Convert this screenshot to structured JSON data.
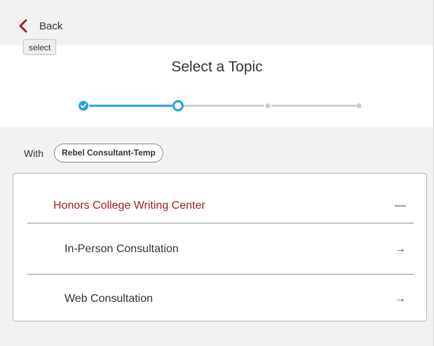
{
  "nav": {
    "back_label": "Back",
    "tooltip": "select"
  },
  "header": {
    "title": "Select a Topic"
  },
  "stepper": {
    "steps": 4,
    "current": 2,
    "accent": "#1fa3e0",
    "inactive": "#cccccc"
  },
  "with": {
    "label": "With",
    "consultant": "Rebel Consultant-Temp"
  },
  "topics": {
    "group_label": "Honors College Writing Center",
    "collapse_icon": "minus-icon",
    "items": [
      {
        "label": "In-Person Consultation",
        "icon": "arrow-right-icon"
      },
      {
        "label": "Web Consultation",
        "icon": "arrow-right-icon"
      }
    ]
  },
  "colors": {
    "brand_red": "#a6192e",
    "background": "#f2f2f2"
  }
}
